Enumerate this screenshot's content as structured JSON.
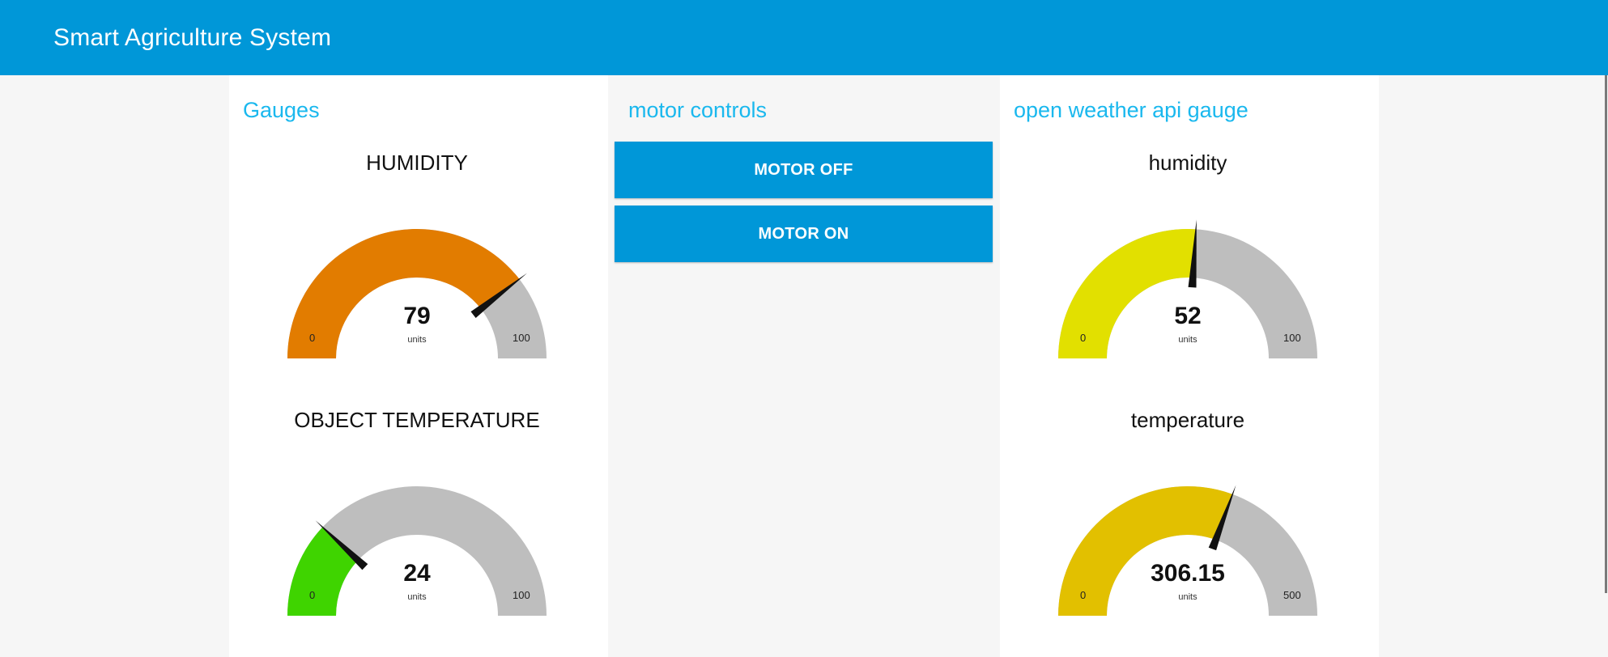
{
  "app": {
    "title": "Smart Agriculture System"
  },
  "colors": {
    "header": "#0097d8",
    "group_title": "#1ab8ee",
    "button": "#0097d8",
    "gauge_track": "#bebebe",
    "needle": "#111111"
  },
  "groups": {
    "gauges": {
      "title": "Gauges",
      "humidity": {
        "label": "HUMIDITY",
        "value": "79",
        "units": "units",
        "min": "0",
        "max": "100",
        "color": "#e27c00"
      },
      "object_temperature": {
        "label": "OBJECT TEMPERATURE",
        "value": "24",
        "units": "units",
        "min": "0",
        "max": "100",
        "color": "#3fd400"
      }
    },
    "motor": {
      "title": "motor controls",
      "off_label": "MOTOR OFF",
      "on_label": "MOTOR ON"
    },
    "weather": {
      "title": "open weather api gauge",
      "humidity": {
        "label": "humidity",
        "value": "52",
        "units": "units",
        "min": "0",
        "max": "100",
        "color": "#e2e000"
      },
      "temperature": {
        "label": "temperature",
        "value": "306.15",
        "units": "units",
        "min": "0",
        "max": "500",
        "color": "#e2c000"
      }
    }
  }
}
